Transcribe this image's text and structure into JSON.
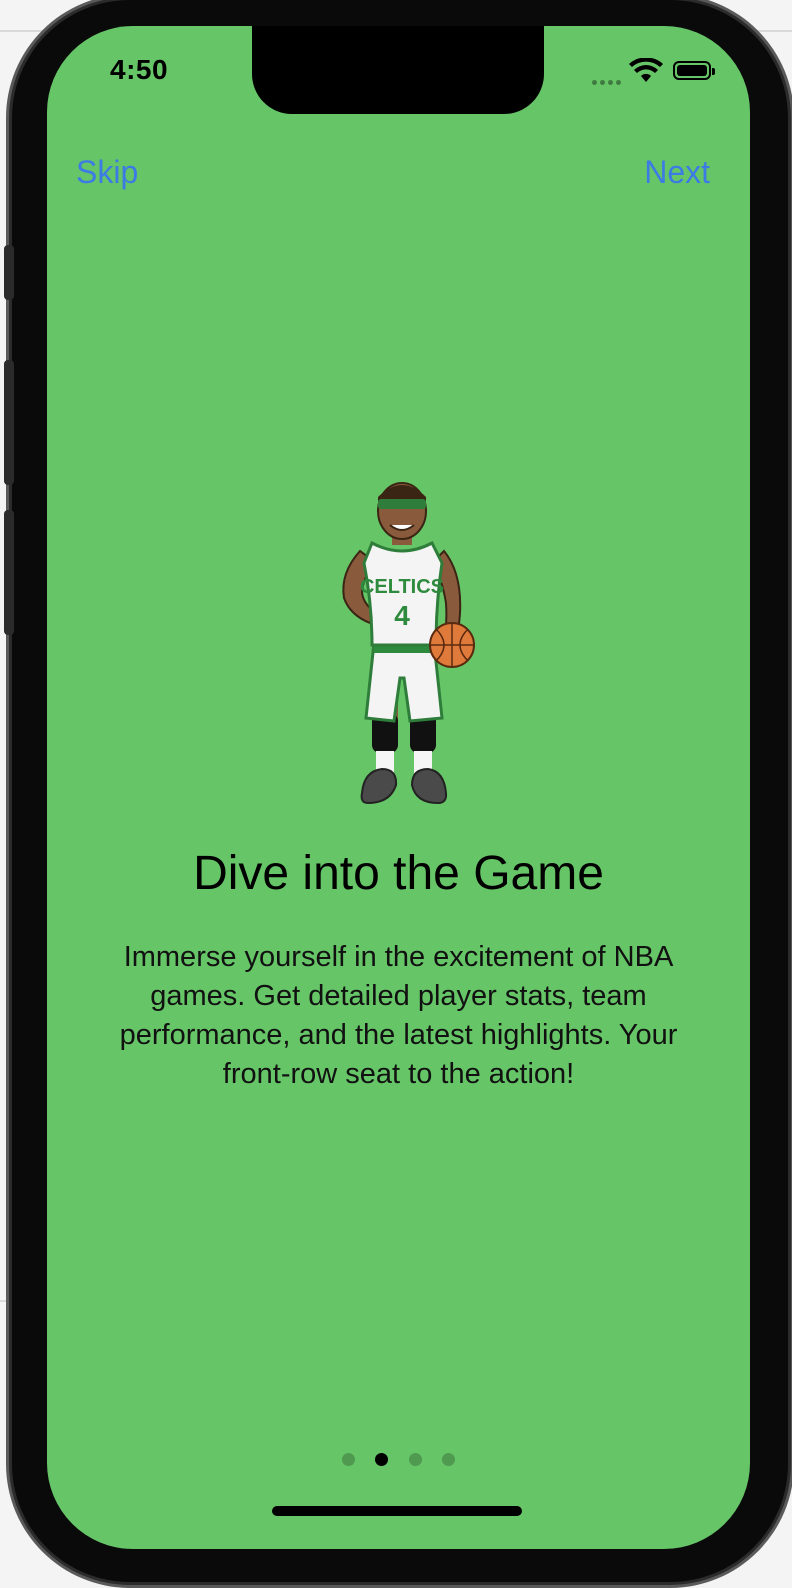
{
  "status_bar": {
    "time": "4:50",
    "icons": [
      "cellular-dots-icon",
      "wifi-icon",
      "battery-icon"
    ]
  },
  "navigation": {
    "skip_label": "Skip",
    "next_label": "Next",
    "link_color": "#3b7be6"
  },
  "onboarding": {
    "title": "Dive into the Game",
    "description": "Immerse yourself in the excitement of NBA games. Get detailed player stats, team performance, and the latest highlights. Your front-row seat to the action!",
    "illustration": "basketball-player-illustration",
    "jersey_team": "CELTICS",
    "jersey_number": "4",
    "background_color": "#66c567"
  },
  "pager": {
    "total_pages": 4,
    "current_page": 2
  }
}
